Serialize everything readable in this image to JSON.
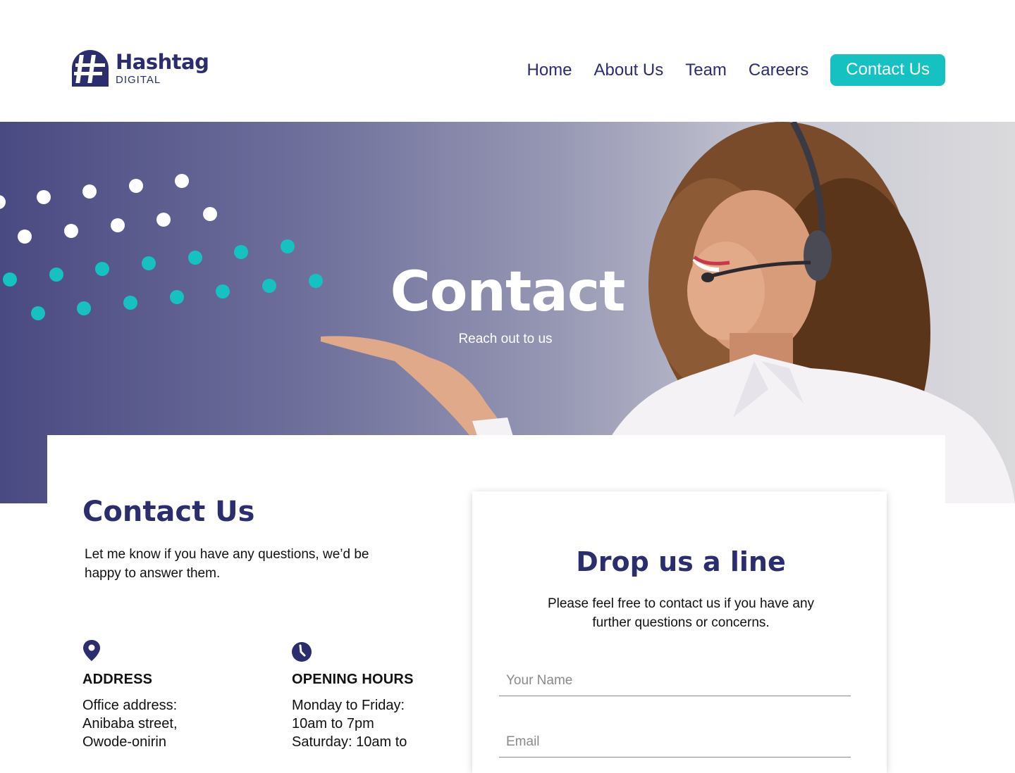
{
  "brand": {
    "name": "Hashtag",
    "sub": "DIGITAL",
    "color": "#2b2d6e",
    "accent": "#15c1c1"
  },
  "nav": {
    "items": [
      {
        "label": "Home"
      },
      {
        "label": "About Us"
      },
      {
        "label": "Team"
      },
      {
        "label": "Careers"
      }
    ],
    "cta": "Contact Us"
  },
  "hero": {
    "title": "Contact",
    "subtitle": "Reach out to us"
  },
  "contact": {
    "heading": "Contact Us",
    "intro": "Let me know if you have any questions, we’d be happy to answer them.",
    "address": {
      "icon": "map-pin-icon",
      "title": "ADDRESS",
      "lines": [
        "Office address:",
        "Anibaba street,",
        "Owode-onirin"
      ]
    },
    "hours": {
      "icon": "clock-icon",
      "title": "OPENING HOURS",
      "lines": [
        "Monday to Friday:",
        "10am to 7pm",
        "Saturday: 10am to"
      ]
    }
  },
  "form": {
    "title": "Drop us a line",
    "description": "Please feel free to contact us if you have any further questions or concerns.",
    "name_placeholder": "Your Name",
    "email_placeholder": "Email"
  }
}
